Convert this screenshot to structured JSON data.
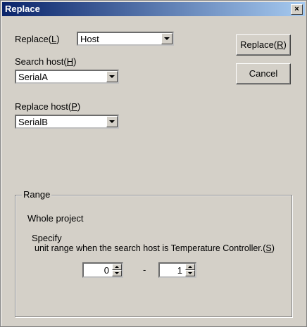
{
  "window": {
    "title": "Replace",
    "close_glyph": "×"
  },
  "replace_by": {
    "label_pre": "Replace(",
    "mnemonic": "L",
    "label_post": ")",
    "value": "Host"
  },
  "search_host": {
    "label_pre": "Search host(",
    "mnemonic": "H",
    "label_post": ")",
    "value": "SerialA"
  },
  "replace_host": {
    "label_pre": "Replace host(",
    "mnemonic": "P",
    "label_post": ")",
    "value": "SerialB"
  },
  "buttons": {
    "replace": {
      "label_pre": "Replace(",
      "mnemonic": "R",
      "label_post": ")"
    },
    "cancel": "Cancel"
  },
  "range": {
    "legend": "Range",
    "whole_project": "Whole project",
    "specify": "Specify",
    "specify_detail_pre": "unit range when the search host is Temperature Controller.(",
    "specify_mnemonic": "S",
    "specify_detail_post": ")",
    "from_value": "0",
    "separator": "-",
    "to_value": "1"
  }
}
